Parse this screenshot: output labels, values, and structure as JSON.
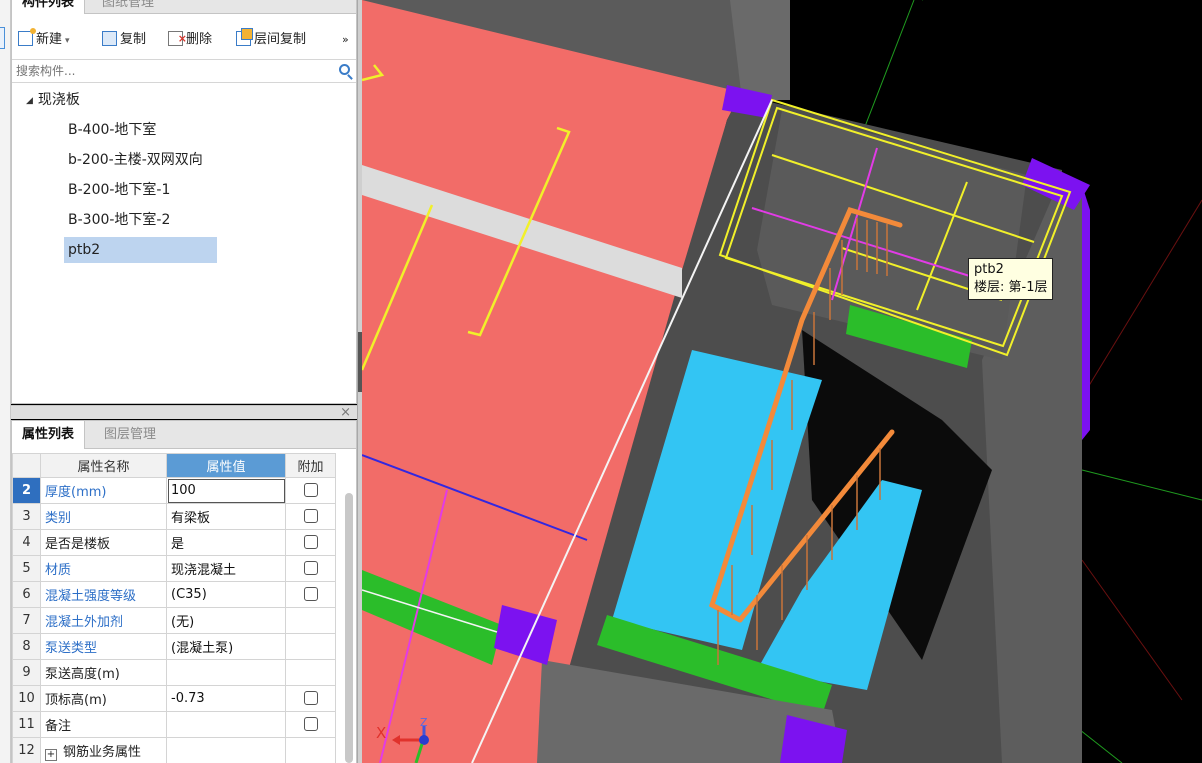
{
  "component_panel": {
    "tabs": [
      "构件列表",
      "图纸管理"
    ],
    "toolbar": {
      "new": "新建",
      "copy": "复制",
      "delete": "删除",
      "floor_copy": "层间复制",
      "more": "»"
    },
    "search_placeholder": "搜索构件...",
    "tree": {
      "root": "现浇板",
      "items": [
        "B-400-地下室",
        "b-200-主楼-双网双向",
        "B-200-地下室-1",
        "B-300-地下室-2",
        "ptb2"
      ],
      "selected": "ptb2"
    }
  },
  "splitter": {
    "close": "×"
  },
  "property_panel": {
    "tabs": [
      "属性列表",
      "图层管理"
    ],
    "columns": [
      "属性名称",
      "属性值",
      "附加"
    ],
    "rows": [
      {
        "num": "2",
        "name": "厚度(mm)",
        "value": "100",
        "link": true,
        "checkbox": true,
        "selected": true
      },
      {
        "num": "3",
        "name": "类别",
        "value": "有梁板",
        "link": true,
        "checkbox": true
      },
      {
        "num": "4",
        "name": "是否是楼板",
        "value": "是",
        "link": false,
        "checkbox": true
      },
      {
        "num": "5",
        "name": "材质",
        "value": "现浇混凝土",
        "link": true,
        "checkbox": true
      },
      {
        "num": "6",
        "name": "混凝土强度等级",
        "value": "(C35)",
        "link": true,
        "checkbox": true
      },
      {
        "num": "7",
        "name": "混凝土外加剂",
        "value": "(无)",
        "link": true,
        "checkbox": false
      },
      {
        "num": "8",
        "name": "泵送类型",
        "value": "(混凝土泵)",
        "link": true,
        "checkbox": false
      },
      {
        "num": "9",
        "name": "泵送高度(m)",
        "value": "",
        "link": false,
        "checkbox": false
      },
      {
        "num": "10",
        "name": "顶标高(m)",
        "value": "-0.73",
        "link": false,
        "checkbox": true
      },
      {
        "num": "11",
        "name": "备注",
        "value": "",
        "link": false,
        "checkbox": true
      },
      {
        "num": "12",
        "name": "钢筋业务属性",
        "value": "",
        "link": false,
        "checkbox": false,
        "expand": "+"
      }
    ]
  },
  "viewport": {
    "tooltip": {
      "name": "ptb2",
      "floor": "楼层: 第-1层"
    },
    "axis": {
      "x": "X",
      "z": "Z"
    }
  },
  "colors": {
    "slab_red": "#f26c68",
    "wall_gray": "#5e5e5e",
    "stair_cyan": "#33c5f3",
    "handrail_orange": "#f38a3a",
    "column_purple": "#7c12f0",
    "beam_green": "#2bbd2a",
    "selection_yellow": "#f1f02a",
    "magenta": "#e23be6"
  }
}
